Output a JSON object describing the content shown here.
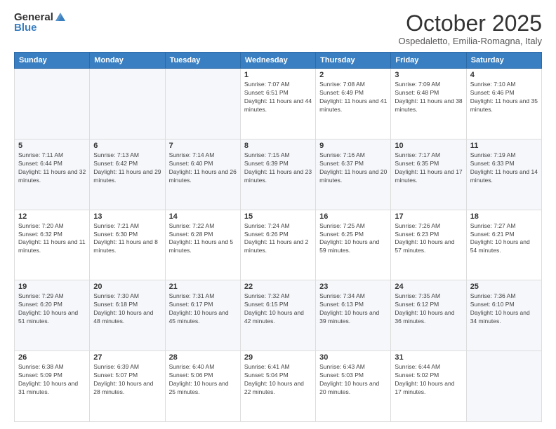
{
  "header": {
    "logo": {
      "general": "General",
      "blue": "Blue"
    },
    "title": "October 2025",
    "location": "Ospedaletto, Emilia-Romagna, Italy"
  },
  "days_of_week": [
    "Sunday",
    "Monday",
    "Tuesday",
    "Wednesday",
    "Thursday",
    "Friday",
    "Saturday"
  ],
  "weeks": [
    {
      "days": [
        {
          "number": "",
          "sunrise": "",
          "sunset": "",
          "daylight": ""
        },
        {
          "number": "",
          "sunrise": "",
          "sunset": "",
          "daylight": ""
        },
        {
          "number": "",
          "sunrise": "",
          "sunset": "",
          "daylight": ""
        },
        {
          "number": "1",
          "sunrise": "Sunrise: 7:07 AM",
          "sunset": "Sunset: 6:51 PM",
          "daylight": "Daylight: 11 hours and 44 minutes."
        },
        {
          "number": "2",
          "sunrise": "Sunrise: 7:08 AM",
          "sunset": "Sunset: 6:49 PM",
          "daylight": "Daylight: 11 hours and 41 minutes."
        },
        {
          "number": "3",
          "sunrise": "Sunrise: 7:09 AM",
          "sunset": "Sunset: 6:48 PM",
          "daylight": "Daylight: 11 hours and 38 minutes."
        },
        {
          "number": "4",
          "sunrise": "Sunrise: 7:10 AM",
          "sunset": "Sunset: 6:46 PM",
          "daylight": "Daylight: 11 hours and 35 minutes."
        }
      ]
    },
    {
      "days": [
        {
          "number": "5",
          "sunrise": "Sunrise: 7:11 AM",
          "sunset": "Sunset: 6:44 PM",
          "daylight": "Daylight: 11 hours and 32 minutes."
        },
        {
          "number": "6",
          "sunrise": "Sunrise: 7:13 AM",
          "sunset": "Sunset: 6:42 PM",
          "daylight": "Daylight: 11 hours and 29 minutes."
        },
        {
          "number": "7",
          "sunrise": "Sunrise: 7:14 AM",
          "sunset": "Sunset: 6:40 PM",
          "daylight": "Daylight: 11 hours and 26 minutes."
        },
        {
          "number": "8",
          "sunrise": "Sunrise: 7:15 AM",
          "sunset": "Sunset: 6:39 PM",
          "daylight": "Daylight: 11 hours and 23 minutes."
        },
        {
          "number": "9",
          "sunrise": "Sunrise: 7:16 AM",
          "sunset": "Sunset: 6:37 PM",
          "daylight": "Daylight: 11 hours and 20 minutes."
        },
        {
          "number": "10",
          "sunrise": "Sunrise: 7:17 AM",
          "sunset": "Sunset: 6:35 PM",
          "daylight": "Daylight: 11 hours and 17 minutes."
        },
        {
          "number": "11",
          "sunrise": "Sunrise: 7:19 AM",
          "sunset": "Sunset: 6:33 PM",
          "daylight": "Daylight: 11 hours and 14 minutes."
        }
      ]
    },
    {
      "days": [
        {
          "number": "12",
          "sunrise": "Sunrise: 7:20 AM",
          "sunset": "Sunset: 6:32 PM",
          "daylight": "Daylight: 11 hours and 11 minutes."
        },
        {
          "number": "13",
          "sunrise": "Sunrise: 7:21 AM",
          "sunset": "Sunset: 6:30 PM",
          "daylight": "Daylight: 11 hours and 8 minutes."
        },
        {
          "number": "14",
          "sunrise": "Sunrise: 7:22 AM",
          "sunset": "Sunset: 6:28 PM",
          "daylight": "Daylight: 11 hours and 5 minutes."
        },
        {
          "number": "15",
          "sunrise": "Sunrise: 7:24 AM",
          "sunset": "Sunset: 6:26 PM",
          "daylight": "Daylight: 11 hours and 2 minutes."
        },
        {
          "number": "16",
          "sunrise": "Sunrise: 7:25 AM",
          "sunset": "Sunset: 6:25 PM",
          "daylight": "Daylight: 10 hours and 59 minutes."
        },
        {
          "number": "17",
          "sunrise": "Sunrise: 7:26 AM",
          "sunset": "Sunset: 6:23 PM",
          "daylight": "Daylight: 10 hours and 57 minutes."
        },
        {
          "number": "18",
          "sunrise": "Sunrise: 7:27 AM",
          "sunset": "Sunset: 6:21 PM",
          "daylight": "Daylight: 10 hours and 54 minutes."
        }
      ]
    },
    {
      "days": [
        {
          "number": "19",
          "sunrise": "Sunrise: 7:29 AM",
          "sunset": "Sunset: 6:20 PM",
          "daylight": "Daylight: 10 hours and 51 minutes."
        },
        {
          "number": "20",
          "sunrise": "Sunrise: 7:30 AM",
          "sunset": "Sunset: 6:18 PM",
          "daylight": "Daylight: 10 hours and 48 minutes."
        },
        {
          "number": "21",
          "sunrise": "Sunrise: 7:31 AM",
          "sunset": "Sunset: 6:17 PM",
          "daylight": "Daylight: 10 hours and 45 minutes."
        },
        {
          "number": "22",
          "sunrise": "Sunrise: 7:32 AM",
          "sunset": "Sunset: 6:15 PM",
          "daylight": "Daylight: 10 hours and 42 minutes."
        },
        {
          "number": "23",
          "sunrise": "Sunrise: 7:34 AM",
          "sunset": "Sunset: 6:13 PM",
          "daylight": "Daylight: 10 hours and 39 minutes."
        },
        {
          "number": "24",
          "sunrise": "Sunrise: 7:35 AM",
          "sunset": "Sunset: 6:12 PM",
          "daylight": "Daylight: 10 hours and 36 minutes."
        },
        {
          "number": "25",
          "sunrise": "Sunrise: 7:36 AM",
          "sunset": "Sunset: 6:10 PM",
          "daylight": "Daylight: 10 hours and 34 minutes."
        }
      ]
    },
    {
      "days": [
        {
          "number": "26",
          "sunrise": "Sunrise: 6:38 AM",
          "sunset": "Sunset: 5:09 PM",
          "daylight": "Daylight: 10 hours and 31 minutes."
        },
        {
          "number": "27",
          "sunrise": "Sunrise: 6:39 AM",
          "sunset": "Sunset: 5:07 PM",
          "daylight": "Daylight: 10 hours and 28 minutes."
        },
        {
          "number": "28",
          "sunrise": "Sunrise: 6:40 AM",
          "sunset": "Sunset: 5:06 PM",
          "daylight": "Daylight: 10 hours and 25 minutes."
        },
        {
          "number": "29",
          "sunrise": "Sunrise: 6:41 AM",
          "sunset": "Sunset: 5:04 PM",
          "daylight": "Daylight: 10 hours and 22 minutes."
        },
        {
          "number": "30",
          "sunrise": "Sunrise: 6:43 AM",
          "sunset": "Sunset: 5:03 PM",
          "daylight": "Daylight: 10 hours and 20 minutes."
        },
        {
          "number": "31",
          "sunrise": "Sunrise: 6:44 AM",
          "sunset": "Sunset: 5:02 PM",
          "daylight": "Daylight: 10 hours and 17 minutes."
        },
        {
          "number": "",
          "sunrise": "",
          "sunset": "",
          "daylight": ""
        }
      ]
    }
  ]
}
